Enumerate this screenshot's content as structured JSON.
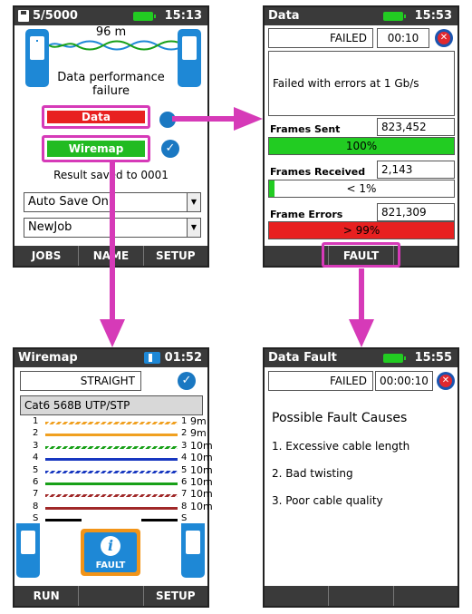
{
  "screen1": {
    "title": "5/5000",
    "time": "15:13",
    "length": "96 m",
    "message_line1": "Data performance",
    "message_line2": "failure",
    "data_btn": "Data",
    "wiremap_btn": "Wiremap",
    "result": "Result saved to 0001",
    "dropdown1": "Auto Save On",
    "dropdown2": "NewJob",
    "softkeys": [
      "JOBS",
      "NAME",
      "SETUP"
    ]
  },
  "screen2": {
    "title": "Data",
    "time": "15:53",
    "status": "FAILED",
    "timer": "00:10",
    "message": "Failed with errors at 1 Gb/s",
    "frames_sent_label": "Frames Sent",
    "frames_sent_value": "823,452",
    "frames_sent_pct": "100%",
    "frames_sent_fill": 1.0,
    "frames_received_label": "Frames Received",
    "frames_received_value": "2,143",
    "frames_received_pct": "< 1%",
    "frames_received_fill": 0.03,
    "frame_errors_label": "Frame Errors",
    "frame_errors_value": "821,309",
    "frame_errors_pct": "> 99%",
    "frame_errors_fill": 1.0,
    "softkey": "FAULT"
  },
  "screen3": {
    "title": "Wiremap",
    "time": "01:52",
    "status": "STRAIGHT",
    "cable": "Cat6 568B UTP/STP",
    "wires": [
      {
        "l": "1",
        "r": "1",
        "len": "9m",
        "color": "#f0a020",
        "striped": true
      },
      {
        "l": "2",
        "r": "2",
        "len": "9m",
        "color": "#f0a020",
        "striped": false
      },
      {
        "l": "3",
        "r": "3",
        "len": "10m",
        "color": "#18a018",
        "striped": true
      },
      {
        "l": "4",
        "r": "4",
        "len": "10m",
        "color": "#1838c0",
        "striped": false
      },
      {
        "l": "5",
        "r": "5",
        "len": "10m",
        "color": "#1838c0",
        "striped": true
      },
      {
        "l": "6",
        "r": "6",
        "len": "10m",
        "color": "#18a018",
        "striped": false
      },
      {
        "l": "7",
        "r": "7",
        "len": "10m",
        "color": "#a02828",
        "striped": true
      },
      {
        "l": "8",
        "r": "8",
        "len": "10m",
        "color": "#a02828",
        "striped": false
      },
      {
        "l": "S",
        "r": "S",
        "len": "",
        "color": "#000000",
        "striped": false
      }
    ],
    "fault_label": "FAULT",
    "info_glyph": "i",
    "softkeys": [
      "RUN",
      "",
      "SETUP"
    ]
  },
  "screen4": {
    "title": "Data Fault",
    "time": "15:55",
    "status": "FAILED",
    "timer": "00:00:10",
    "heading": "Possible Fault Causes",
    "causes": [
      "1. Excessive cable length",
      "2. Bad twisting",
      "3. Poor cable quality"
    ],
    "softkeys": [
      "",
      "",
      ""
    ]
  },
  "colors": {
    "accent": "#d63ab8",
    "pass": "#22cc22",
    "fail": "#e82020",
    "device": "#1e88d6"
  },
  "icons": [
    "save-icon",
    "battery-icon",
    "check-icon",
    "fail-x-icon",
    "info-icon",
    "remote-device-icon"
  ]
}
